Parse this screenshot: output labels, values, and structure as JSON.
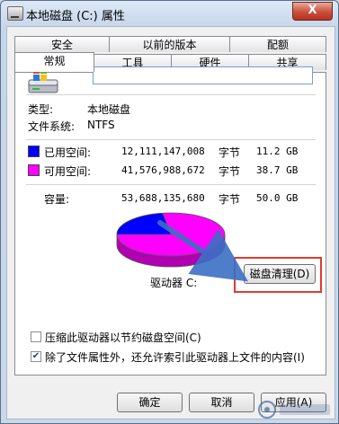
{
  "window": {
    "title": "本地磁盘 (C:) 属性",
    "close_glyph": "X"
  },
  "tabs": {
    "row1": [
      "安全",
      "以前的版本",
      "配额"
    ],
    "row2": [
      "常规",
      "工具",
      "硬件",
      "共享"
    ],
    "active": "常规"
  },
  "general": {
    "drive_name_value": "",
    "type_label": "类型:",
    "type_value": "本地磁盘",
    "fs_label": "文件系统:",
    "fs_value": "NTFS",
    "used": {
      "label": "已用空间:",
      "bytes": "12,111,147,008",
      "unit": "字节",
      "size": "11.2 GB",
      "color": "#0000ff"
    },
    "free": {
      "label": "可用空间:",
      "bytes": "41,576,988,672",
      "unit": "字节",
      "size": "38.7 GB",
      "color": "#ff00ff"
    },
    "capacity": {
      "label": "容量:",
      "bytes": "53,688,135,680",
      "unit": "字节",
      "size": "50.0 GB"
    },
    "drive_caption": "驱动器 C:",
    "cleanup_button": "磁盘清理(D)",
    "used_fraction": 0.2256
  },
  "options": {
    "compress": {
      "label": "压缩此驱动器以节约磁盘空间(C)",
      "checked": false
    },
    "index": {
      "label": "除了文件属性外，还允许索引此驱动器上文件的内容(I)",
      "checked": true
    }
  },
  "buttons": {
    "ok": "确定",
    "cancel": "取消",
    "apply": "应用(A)"
  },
  "annotation": {
    "highlight_color": "#e23b2e",
    "arrow_color": "#3b6fc4"
  },
  "icons": {
    "drive": "drive-icon",
    "app": "drive-icon",
    "close": "close-icon",
    "check": "checkmark-icon"
  }
}
